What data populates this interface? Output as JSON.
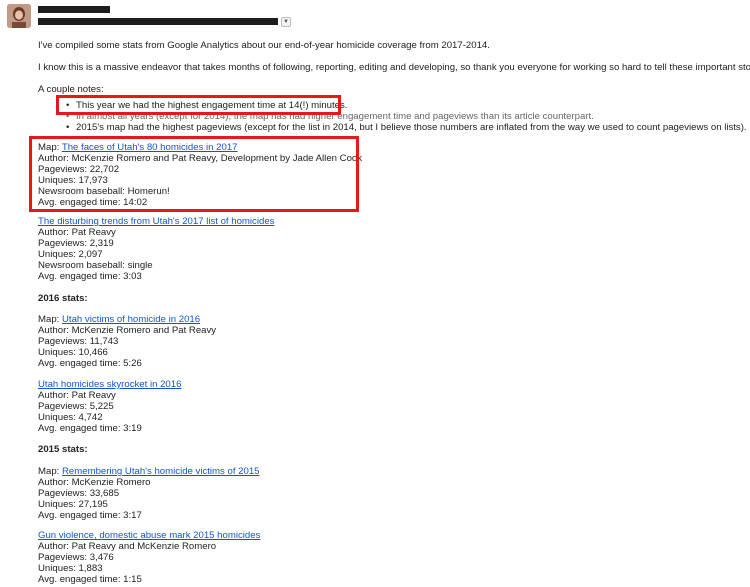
{
  "email": {
    "intro": "I've compiled some stats from Google Analytics about our end-of-year homicide coverage from 2017-2014.",
    "thanks": "I know this is a massive endeavor that takes months of following, reporting, editing and developing, so thank you everyone for working so hard to tell these important stories.",
    "notes_heading": "A couple notes:",
    "notes": [
      "This year we had the highest engagement time at 14(!) minutes.",
      "In almost all years (except for 2014), the map has had higher engagement time and pageviews than its article counterpart.",
      "2015's map had the highest pageviews (except for the list in 2014, but I believe those numbers are inflated from the way we used to count pageviews on lists)."
    ]
  },
  "stories_2017": {
    "map_prefix": "Map: ",
    "map_link": "The faces of Utah's 80 homicides in 2017",
    "map_author": "Author: McKenzie Romero and Pat Reavy, Development by Jade Allen Cook",
    "map_pageviews": "Pageviews: 22,702",
    "map_uniques": "Uniques: 17,973",
    "map_baseball": "Newsroom baseball: Homerun!",
    "map_engaged": "Avg. engaged time: 14:02",
    "article_link": "The disturbing trends from Utah's 2017 list of homicides",
    "article_author": "Author: Pat Reavy",
    "article_pageviews": "Pageviews: 2,319",
    "article_uniques": "Uniques: 2,097",
    "article_baseball": "Newsroom baseball: single",
    "article_engaged": "Avg. engaged time: 3:03"
  },
  "stories_2016": {
    "heading": "2016 stats:",
    "map_prefix": "Map: ",
    "map_link": "Utah victims of homicide in 2016",
    "map_author": "Author: McKenzie Romero and Pat Reavy",
    "map_pageviews": "Pageviews: 11,743",
    "map_uniques": "Uniques: 10,466",
    "map_engaged": "Avg. engaged time: 5:26",
    "article_link": "Utah homicides skyrocket in 2016",
    "article_author": "Author: Pat Reavy",
    "article_pageviews": "Pageviews: 5,225",
    "article_uniques": "Uniques: 4,742",
    "article_engaged": "Avg. engaged time: 3:19"
  },
  "stories_2015": {
    "heading": "2015 stats:",
    "map_prefix": "Map: ",
    "map_link": "Remembering Utah's homicide victims of 2015",
    "map_author": "Author: McKenzie Romero",
    "map_pageviews": "Pageviews: 33,685",
    "map_uniques": "Uniques: 27,195",
    "map_engaged": "Avg. engaged time: 3:17",
    "article_link": "Gun violence, domestic abuse mark 2015 homicides",
    "article_author": "Author: Pat Reavy and McKenzie Romero",
    "article_pageviews": "Pageviews: 3,476",
    "article_uniques": "Uniques: 1,883",
    "article_engaged": "Avg. engaged time: 1:15"
  },
  "colors": {
    "link": "#1155cc",
    "highlight_box": "#e3191b"
  }
}
